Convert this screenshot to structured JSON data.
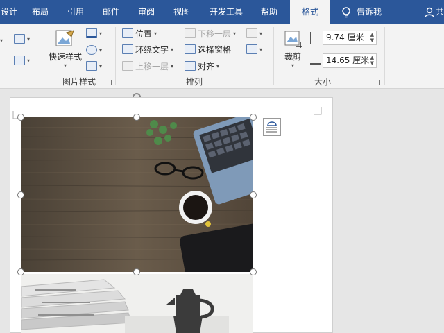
{
  "tabs": [
    {
      "label": "设计"
    },
    {
      "label": "布局"
    },
    {
      "label": "引用"
    },
    {
      "label": "邮件"
    },
    {
      "label": "审阅"
    },
    {
      "label": "视图"
    },
    {
      "label": "开发工具"
    },
    {
      "label": "帮助"
    },
    {
      "label": "格式"
    }
  ],
  "tell_me": {
    "label": "告诉我"
  },
  "share": {
    "label": "共"
  },
  "groups": {
    "picture_styles": {
      "label": "图片样式",
      "quick_styles": "快速样式"
    },
    "arrange": {
      "label": "排列",
      "position": "位置",
      "wrap_text": "环绕文字",
      "bring_forward": "上移一层",
      "send_backward": "下移一层",
      "selection_pane": "选择窗格",
      "align": "对齐"
    },
    "size": {
      "label": "大小",
      "crop": "裁剪",
      "height": "9.74 厘米",
      "width": "14.65 厘米"
    }
  },
  "colors": {
    "tab_bar": "#2b579a",
    "ribbon": "#f3f3f3",
    "canvas": "#e6e6e6"
  }
}
